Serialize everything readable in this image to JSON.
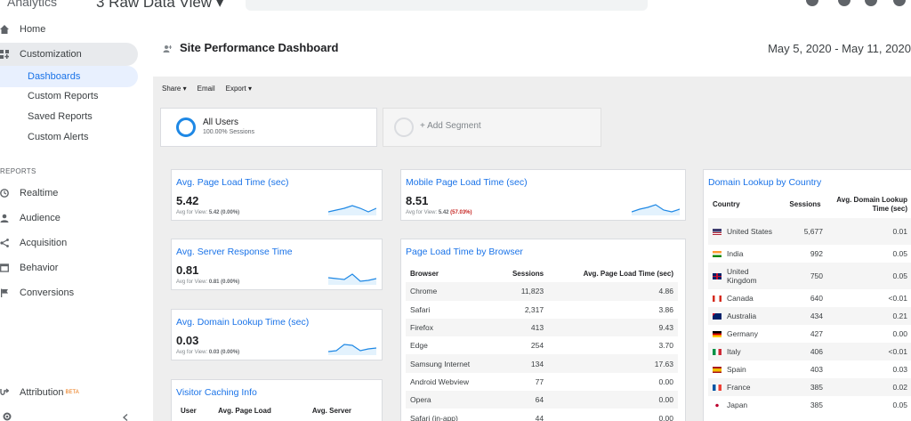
{
  "topbar": {
    "product": "Analytics",
    "view_name": "3 Raw Data View"
  },
  "sidebar": {
    "home": "Home",
    "customization": "Customization",
    "sub_items": [
      "Dashboards",
      "Custom Reports",
      "Saved Reports",
      "Custom Alerts"
    ],
    "section": "REPORTS",
    "reports": [
      "Realtime",
      "Audience",
      "Acquisition",
      "Behavior",
      "Conversions"
    ],
    "attribution": "Attribution",
    "attribution_badge": "BETA"
  },
  "header": {
    "title": "Site Performance Dashboard",
    "date_range": "May 5, 2020 - May 11, 2020"
  },
  "actions": {
    "share": "Share",
    "email": "Email",
    "export": "Export"
  },
  "segments": {
    "all_users": "All Users",
    "all_users_pct": "100.00% Sessions",
    "add_segment": "+ Add Segment"
  },
  "widgets": {
    "page_load": {
      "title": "Avg. Page Load Time (sec)",
      "value": "5.42",
      "sub_prefix": "Avg for View:",
      "sub_value": "5.42 (0.00%)"
    },
    "server_response": {
      "title": "Avg. Server Response Time",
      "value": "0.81",
      "sub_prefix": "Avg for View:",
      "sub_value": "0.81 (0.00%)"
    },
    "domain_lookup": {
      "title": "Avg. Domain Lookup Time (sec)",
      "value": "0.03",
      "sub_prefix": "Avg for View:",
      "sub_value": "0.03 (0.00%)"
    },
    "visitor_caching": {
      "title": "Visitor Caching Info",
      "headers": [
        "User",
        "Avg. Page Load",
        "Avg. Server"
      ]
    },
    "mobile_load": {
      "title": "Mobile Page Load Time (sec)",
      "value": "8.51",
      "sub_prefix": "Avg for View:",
      "sub_value_a": "5.42",
      "sub_value_b": "(57.03%)"
    },
    "browser": {
      "title": "Page Load Time by Browser",
      "headers": [
        "Browser",
        "Sessions",
        "Avg. Page Load Time (sec)"
      ],
      "rows": [
        [
          "Chrome",
          "11,823",
          "4.86"
        ],
        [
          "Safari",
          "2,317",
          "3.86"
        ],
        [
          "Firefox",
          "413",
          "9.43"
        ],
        [
          "Edge",
          "254",
          "3.70"
        ],
        [
          "Samsung Internet",
          "134",
          "17.63"
        ],
        [
          "Android Webview",
          "77",
          "0.00"
        ],
        [
          "Opera",
          "64",
          "0.00"
        ],
        [
          "Safari (in-app)",
          "44",
          "0.00"
        ]
      ]
    },
    "country": {
      "title": "Domain Lookup by Country",
      "headers": [
        "Country",
        "Sessions",
        "Avg. Domain Lookup Time (sec)"
      ],
      "rows": [
        [
          "United States",
          "5,677",
          "0.01",
          "us"
        ],
        [
          "India",
          "992",
          "0.05",
          "in"
        ],
        [
          "United Kingdom",
          "750",
          "0.05",
          "gb"
        ],
        [
          "Canada",
          "640",
          "<0.01",
          "ca"
        ],
        [
          "Australia",
          "434",
          "0.21",
          "au"
        ],
        [
          "Germany",
          "427",
          "0.00",
          "de"
        ],
        [
          "Italy",
          "406",
          "<0.01",
          "it"
        ],
        [
          "Spain",
          "403",
          "0.03",
          "es"
        ],
        [
          "France",
          "385",
          "0.02",
          "fr"
        ],
        [
          "Japan",
          "385",
          "0.05",
          "jp"
        ]
      ]
    }
  },
  "colors": {
    "accent": "#1a73e8",
    "spark": "#1e88e5",
    "spark_fill": "#e3f2fd",
    "warn": "#c5221f"
  }
}
